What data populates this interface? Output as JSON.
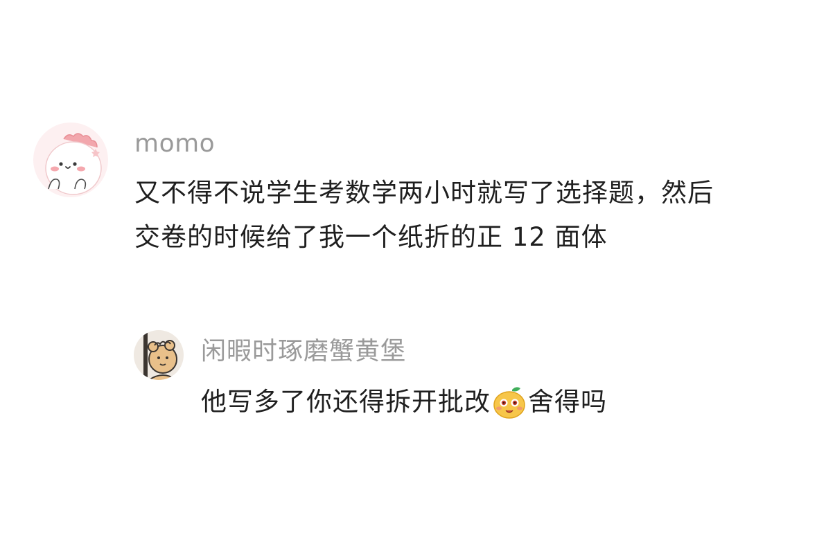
{
  "comment": {
    "username": "momo",
    "text_line1": "又不得不说学生考数学两小时就写了选择题，然后",
    "text_line2": "交卷的时候给了我一个纸折的正 12 面体",
    "avatar_icon": "pink-dinosaur-avatar"
  },
  "reply": {
    "username": "闲暇时琢磨蟹黄堡",
    "text_before_emoji": "他写多了你还得拆开批改",
    "emoji_icon": "yellow-smiling-emoji",
    "text_after_emoji": "舍得吗",
    "avatar_icon": "cartoon-bear-avatar"
  },
  "colors": {
    "username": "#9a9a9a",
    "body_text": "#1f1f1f",
    "background": "#ffffff"
  }
}
